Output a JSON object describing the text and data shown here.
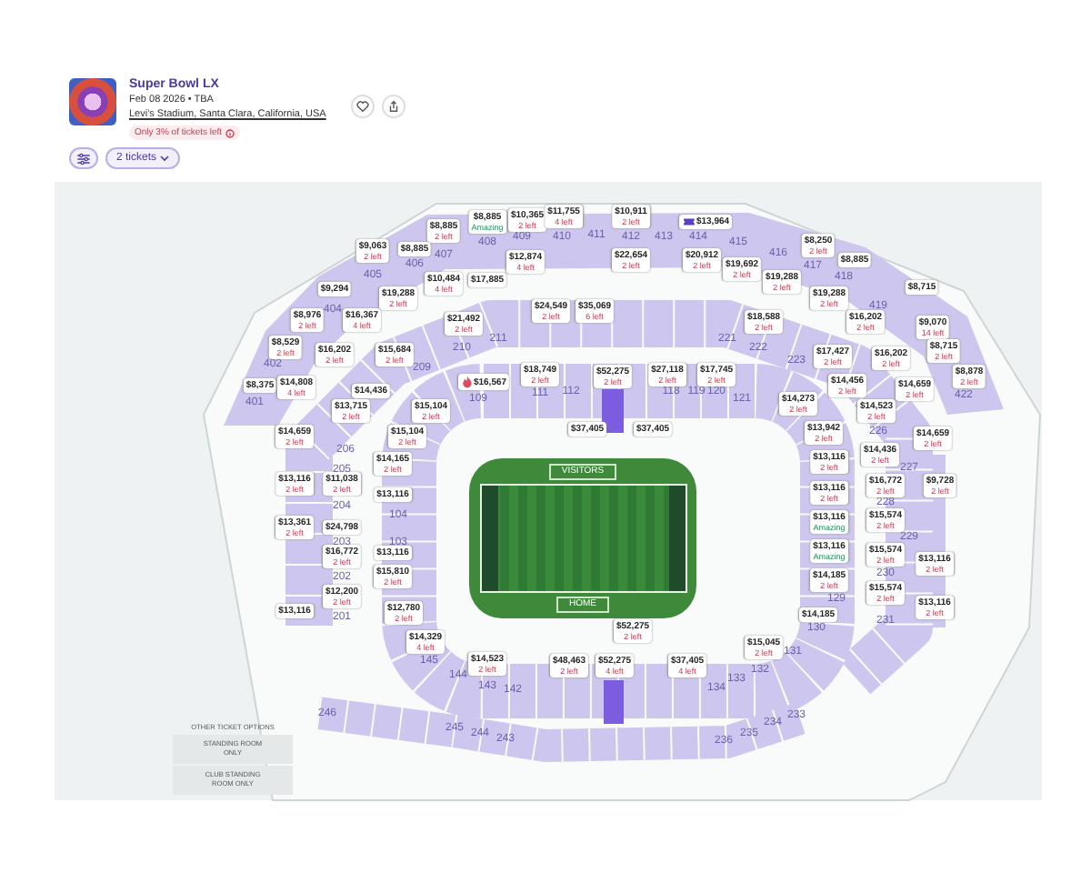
{
  "event": {
    "title": "Super Bowl LX",
    "date": "Feb 08 2026 • TBA",
    "venue": "Levi's Stadium, Santa Clara, California, USA",
    "availability": "Only 3% of tickets left"
  },
  "toolbar": {
    "ticket_count": "2 tickets"
  },
  "map": {
    "field": {
      "top_label": "VISITORS",
      "bottom_label": "HOME"
    },
    "sections": [
      "408",
      "409",
      "410",
      "411",
      "412",
      "413",
      "414",
      "415",
      "406",
      "407",
      "416",
      "417",
      "405",
      "418",
      "404",
      "419",
      "210",
      "211",
      "221",
      "222",
      "402",
      "209",
      "223",
      "401",
      "109",
      "111",
      "112",
      "118",
      "119",
      "120",
      "121",
      "422",
      "226",
      "206",
      "205",
      "227",
      "204",
      "104",
      "228",
      "203",
      "103",
      "229",
      "202",
      "230",
      "129",
      "201",
      "130",
      "231",
      "145",
      "131",
      "144",
      "133",
      "132",
      "143",
      "142",
      "134",
      "246",
      "234",
      "233",
      "245",
      "244",
      "243",
      "236",
      "235"
    ],
    "price_tags": [
      {
        "kind": "deal",
        "price": "$8,885",
        "note": "Amazing"
      },
      {
        "kind": "limited",
        "price": "$10,365",
        "note": "2 left"
      },
      {
        "kind": "limited",
        "price": "$11,755",
        "note": "4 left"
      },
      {
        "kind": "limited",
        "price": "$10,911",
        "note": "2 left"
      },
      {
        "kind": "ticket",
        "price": "$13,964"
      },
      {
        "kind": "limited",
        "price": "$8,885",
        "note": "2 left"
      },
      {
        "kind": "limited",
        "price": "$9,063",
        "note": "2 left"
      },
      {
        "kind": "plain",
        "price": "$8,885"
      },
      {
        "kind": "limited",
        "price": "$8,250",
        "note": "2 left"
      },
      {
        "kind": "limited",
        "price": "$12,874",
        "note": "4 left"
      },
      {
        "kind": "limited",
        "price": "$22,654",
        "note": "2 left"
      },
      {
        "kind": "limited",
        "price": "$20,912",
        "note": "2 left"
      },
      {
        "kind": "limited",
        "price": "$19,692",
        "note": "2 left"
      },
      {
        "kind": "plain",
        "price": "$8,885"
      },
      {
        "kind": "plain",
        "price": "$9,294"
      },
      {
        "kind": "limited",
        "price": "$10,484",
        "note": "4 left"
      },
      {
        "kind": "plain",
        "price": "$17,885"
      },
      {
        "kind": "limited",
        "price": "$19,288",
        "note": "2 left"
      },
      {
        "kind": "plain",
        "price": "$8,715"
      },
      {
        "kind": "limited",
        "price": "$19,288",
        "note": "2 left"
      },
      {
        "kind": "limited",
        "price": "$19,288",
        "note": "2 left"
      },
      {
        "kind": "limited",
        "price": "$8,976",
        "note": "2 left"
      },
      {
        "kind": "limited",
        "price": "$16,367",
        "note": "4 left"
      },
      {
        "kind": "limited",
        "price": "$21,492",
        "note": "2 left"
      },
      {
        "kind": "limited",
        "price": "$24,549",
        "note": "2 left"
      },
      {
        "kind": "limited",
        "price": "$35,069",
        "note": "6 left"
      },
      {
        "kind": "limited",
        "price": "$18,588",
        "note": "2 left"
      },
      {
        "kind": "limited",
        "price": "$16,202",
        "note": "2 left"
      },
      {
        "kind": "limited",
        "price": "$9,070",
        "note": "14 left"
      },
      {
        "kind": "limited",
        "price": "$8,529",
        "note": "2 left"
      },
      {
        "kind": "limited",
        "price": "$16,202",
        "note": "2 left"
      },
      {
        "kind": "limited",
        "price": "$15,684",
        "note": "2 left"
      },
      {
        "kind": "limited",
        "price": "$17,427",
        "note": "2 left"
      },
      {
        "kind": "limited",
        "price": "$16,202",
        "note": "2 left"
      },
      {
        "kind": "limited",
        "price": "$8,715",
        "note": "2 left"
      },
      {
        "kind": "plain",
        "price": "$8,375"
      },
      {
        "kind": "limited",
        "price": "$14,808",
        "note": "4 left"
      },
      {
        "kind": "plain",
        "price": "$14,436"
      },
      {
        "kind": "flame",
        "price": "$16,567"
      },
      {
        "kind": "limited",
        "price": "$18,749",
        "note": "2 left"
      },
      {
        "kind": "limited",
        "price": "$52,275",
        "note": "2 left"
      },
      {
        "kind": "limited",
        "price": "$27,118",
        "note": "2 left"
      },
      {
        "kind": "limited",
        "price": "$17,745",
        "note": "2 left"
      },
      {
        "kind": "limited",
        "price": "$14,456",
        "note": "2 left"
      },
      {
        "kind": "limited",
        "price": "$14,659",
        "note": "2 left"
      },
      {
        "kind": "limited",
        "price": "$8,878",
        "note": "2 left"
      },
      {
        "kind": "limited",
        "price": "$13,715",
        "note": "2 left"
      },
      {
        "kind": "limited",
        "price": "$15,104",
        "note": "2 left"
      },
      {
        "kind": "limited",
        "price": "$14,273",
        "note": "2 left"
      },
      {
        "kind": "limited",
        "price": "$14,523",
        "note": "2 left"
      },
      {
        "kind": "limited",
        "price": "$14,659",
        "note": "2 left"
      },
      {
        "kind": "limited",
        "price": "$15,104",
        "note": "2 left"
      },
      {
        "kind": "plain",
        "price": "$37,405"
      },
      {
        "kind": "plain",
        "price": "$37,405"
      },
      {
        "kind": "limited",
        "price": "$13,942",
        "note": "2 left"
      },
      {
        "kind": "limited",
        "price": "$14,659",
        "note": "2 left"
      },
      {
        "kind": "limited",
        "price": "$14,165",
        "note": "2 left"
      },
      {
        "kind": "limited",
        "price": "$13,116",
        "note": "2 left"
      },
      {
        "kind": "limited",
        "price": "$14,436",
        "note": "2 left"
      },
      {
        "kind": "limited",
        "price": "$13,116",
        "note": "2 left"
      },
      {
        "kind": "limited",
        "price": "$11,038",
        "note": "2 left"
      },
      {
        "kind": "plain",
        "price": "$13,116"
      },
      {
        "kind": "limited",
        "price": "$13,116",
        "note": "2 left"
      },
      {
        "kind": "limited",
        "price": "$16,772",
        "note": "2 left"
      },
      {
        "kind": "limited",
        "price": "$9,728",
        "note": "2 left"
      },
      {
        "kind": "limited",
        "price": "$13,361",
        "note": "2 left"
      },
      {
        "kind": "plain",
        "price": "$24,798"
      },
      {
        "kind": "deal",
        "price": "$13,116",
        "note": "Amazing"
      },
      {
        "kind": "limited",
        "price": "$15,574",
        "note": "2 left"
      },
      {
        "kind": "limited",
        "price": "$16,772",
        "note": "2 left"
      },
      {
        "kind": "plain",
        "price": "$13,116"
      },
      {
        "kind": "deal",
        "price": "$13,116",
        "note": "Amazing"
      },
      {
        "kind": "limited",
        "price": "$15,574",
        "note": "2 left"
      },
      {
        "kind": "limited",
        "price": "$13,116",
        "note": "2 left"
      },
      {
        "kind": "limited",
        "price": "$15,810",
        "note": "2 left"
      },
      {
        "kind": "limited",
        "price": "$14,185",
        "note": "2 left"
      },
      {
        "kind": "limited",
        "price": "$12,200",
        "note": "2 left"
      },
      {
        "kind": "limited",
        "price": "$15,574",
        "note": "2 left"
      },
      {
        "kind": "plain",
        "price": "$13,116"
      },
      {
        "kind": "limited",
        "price": "$12,780",
        "note": "2 left"
      },
      {
        "kind": "plain",
        "price": "$14,185"
      },
      {
        "kind": "limited",
        "price": "$13,116",
        "note": "2 left"
      },
      {
        "kind": "limited",
        "price": "$14,329",
        "note": "4 left"
      },
      {
        "kind": "limited",
        "price": "$52,275",
        "note": "2 left"
      },
      {
        "kind": "limited",
        "price": "$15,045",
        "note": "2 left"
      },
      {
        "kind": "limited",
        "price": "$14,523",
        "note": "2 left"
      },
      {
        "kind": "limited",
        "price": "$48,463",
        "note": "2 left"
      },
      {
        "kind": "limited",
        "price": "$52,275",
        "note": "4 left"
      },
      {
        "kind": "limited",
        "price": "$37,405",
        "note": "4 left"
      }
    ]
  },
  "other_ticket_options": {
    "heading": "OTHER TICKET OPTIONS",
    "options": [
      "STANDING ROOM ONLY",
      "CLUB STANDING ROOM ONLY"
    ]
  }
}
